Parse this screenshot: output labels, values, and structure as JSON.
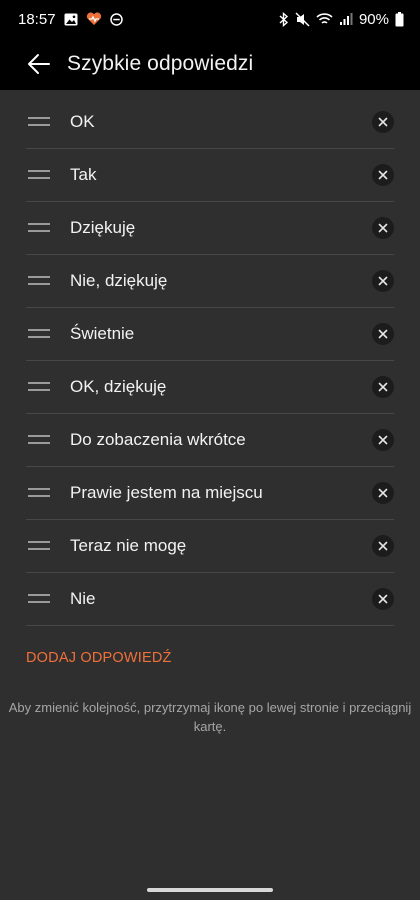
{
  "status_bar": {
    "time": "18:57",
    "battery": "90%",
    "icons": [
      "gallery-icon",
      "heart-app-icon",
      "do-not-disturb-icon",
      "bluetooth-icon",
      "mute-icon",
      "wifi-icon",
      "signal-icon",
      "battery-icon"
    ]
  },
  "app_bar": {
    "title": "Szybkie odpowiedzi",
    "back_icon": "arrow-left-icon"
  },
  "replies": [
    {
      "label": "OK"
    },
    {
      "label": "Tak"
    },
    {
      "label": "Dziękuję"
    },
    {
      "label": "Nie, dziękuję"
    },
    {
      "label": "Świetnie"
    },
    {
      "label": "OK, dziękuję"
    },
    {
      "label": "Do zobaczenia wkrótce"
    },
    {
      "label": "Prawie jestem na miejscu"
    },
    {
      "label": "Teraz nie mogę"
    },
    {
      "label": "Nie"
    }
  ],
  "add_button": "DODAJ ODPOWIEDŹ",
  "hint": "Aby zmienić kolejność, przytrzymaj ikonę po lewej stronie i przeciągnij kartę.",
  "colors": {
    "accent": "#f0703a",
    "background": "#2f2f2f",
    "bar": "#000000"
  }
}
